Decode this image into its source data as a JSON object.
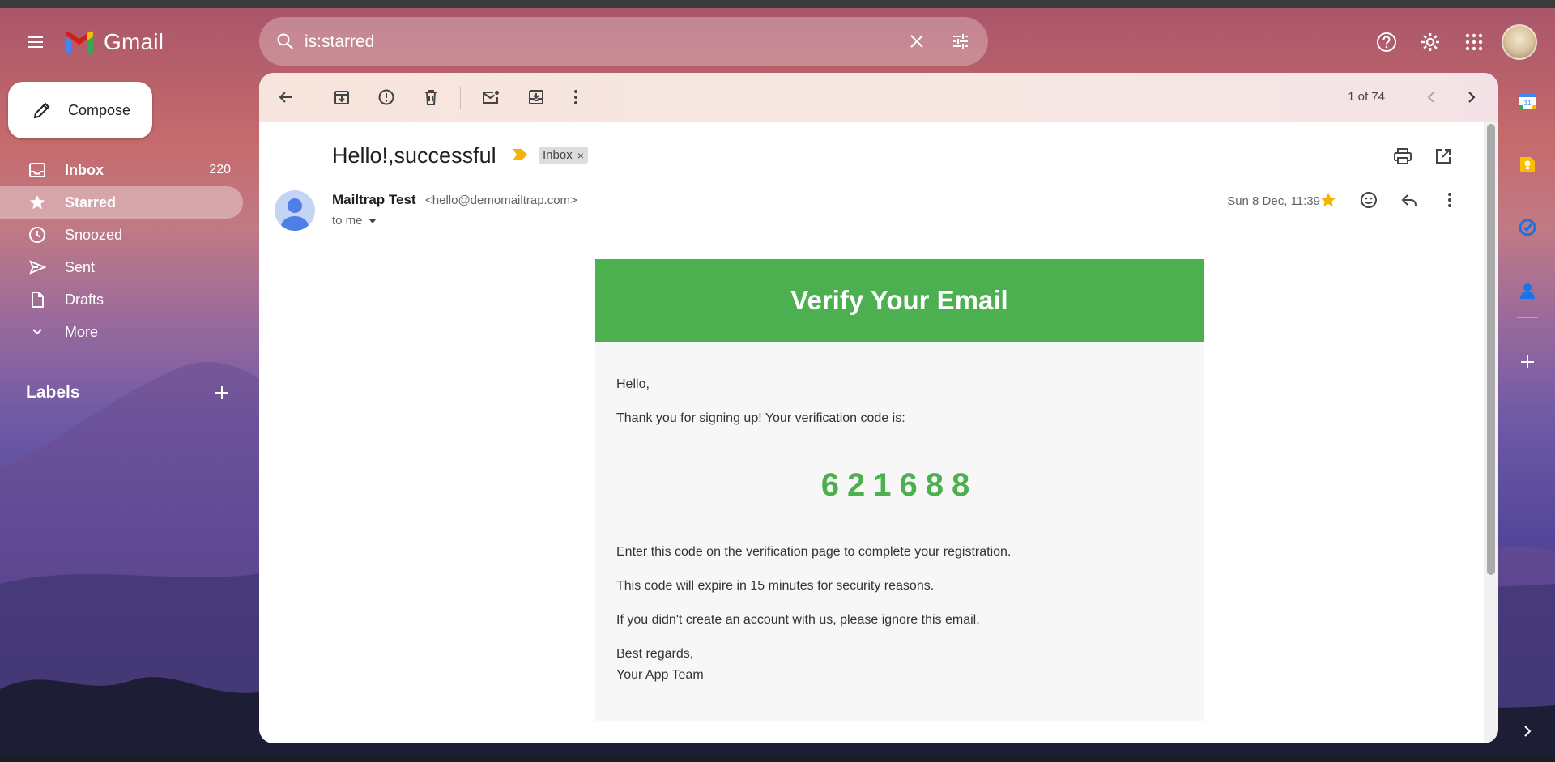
{
  "app": {
    "name": "Gmail"
  },
  "search": {
    "value": "is:starred"
  },
  "compose": {
    "label": "Compose"
  },
  "nav": [
    {
      "id": "inbox",
      "label": "Inbox",
      "count": "220",
      "icon": "inbox-icon"
    },
    {
      "id": "starred",
      "label": "Starred",
      "count": "",
      "icon": "star-icon"
    },
    {
      "id": "snoozed",
      "label": "Snoozed",
      "count": "",
      "icon": "clock-icon"
    },
    {
      "id": "sent",
      "label": "Sent",
      "count": "",
      "icon": "send-icon"
    },
    {
      "id": "drafts",
      "label": "Drafts",
      "count": "",
      "icon": "draft-icon"
    },
    {
      "id": "more",
      "label": "More",
      "count": "",
      "icon": "chevron-down-icon"
    }
  ],
  "labels": {
    "title": "Labels"
  },
  "pager": {
    "text": "1 of 74"
  },
  "message": {
    "subject": "Hello!,successful",
    "label_chip": "Inbox",
    "label_chip_close": "×",
    "sender_name": "Mailtrap Test",
    "sender_email": "<hello@demomailtrap.com>",
    "recipient": "to me",
    "date": "Sun 8 Dec, 11:39"
  },
  "email": {
    "header": "Verify Your Email",
    "greeting": "Hello,",
    "intro": "Thank you for signing up! Your verification code is:",
    "code": "621688",
    "line1": "Enter this code on the verification page to complete your registration.",
    "line2": "This code will expire in 15 minutes for security reasons.",
    "line3": "If you didn't create an account with us, please ignore this email.",
    "signoff": "Best regards,",
    "signature": "Your App Team"
  },
  "colors": {
    "accent_green": "#4caf50",
    "star_yellow": "#f4b400",
    "important_yellow": "#f4b400"
  }
}
